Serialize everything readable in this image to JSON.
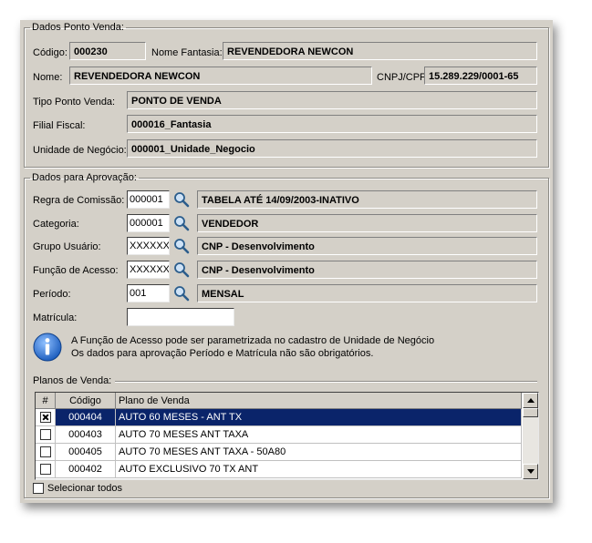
{
  "group_ponto_venda": {
    "legend": "Dados Ponto Venda:",
    "codigo_label": "Código:",
    "codigo_value": "000230",
    "nome_fantasia_label": "Nome Fantasia:",
    "nome_fantasia_value": "REVENDEDORA NEWCON",
    "nome_label": "Nome:",
    "nome_value": "REVENDEDORA NEWCON",
    "cnpj_label": "CNPJ/CPF:",
    "cnpj_value": "15.289.229/0001-65",
    "tipo_label": "Tipo Ponto Venda:",
    "tipo_value": "PONTO DE VENDA",
    "filial_label": "Filial Fiscal:",
    "filial_value": "000016_Fantasia",
    "unidade_label": "Unidade de Negócio:",
    "unidade_value": "000001_Unidade_Negocio"
  },
  "group_aprovacao": {
    "legend": "Dados para Aprovação:",
    "regra_label": "Regra de Comissão:",
    "regra_code": "000001",
    "regra_desc": "TABELA ATÉ 14/09/2003-INATIVO",
    "categoria_label": "Categoria:",
    "categoria_code": "000001",
    "categoria_desc": "VENDEDOR",
    "grupo_label": "Grupo Usuário:",
    "grupo_code": "XXXXXX",
    "grupo_desc": "CNP - Desenvolvimento",
    "funcao_label": "Função de Acesso:",
    "funcao_code": "XXXXXX",
    "funcao_desc": "CNP - Desenvolvimento",
    "periodo_label": "Período:",
    "periodo_code": "001",
    "periodo_desc": "MENSAL",
    "matricula_label": "Matrícula:",
    "matricula_value": "",
    "info_line1": "A Função de Acesso pode ser parametrizada no cadastro de Unidade de Negócio",
    "info_line2": "Os dados para aprovação Período e Matrícula não são obrigatórios.",
    "planos_legend": "Planos de Venda:",
    "table": {
      "headers": [
        "#",
        "Código",
        "Plano de Venda"
      ],
      "rows": [
        {
          "checked": true,
          "codigo": "000404",
          "plano": "AUTO 60 MESES - ANT TX",
          "selected": true
        },
        {
          "checked": false,
          "codigo": "000403",
          "plano": "AUTO 70 MESES ANT TAXA",
          "selected": false
        },
        {
          "checked": false,
          "codigo": "000405",
          "plano": "AUTO 70 MESES ANT TAXA - 50A80",
          "selected": false
        },
        {
          "checked": false,
          "codigo": "000402",
          "plano": "AUTO EXCLUSIVO 70 TX ANT",
          "selected": false
        }
      ]
    },
    "select_all_label": "Selecionar todos"
  },
  "icons": [
    "search-icon",
    "info-icon",
    "scroll-up-icon",
    "scroll-down-icon"
  ],
  "colors": {
    "background": "#d4d0c8",
    "selection": "#0a246a",
    "info_icon": "#1f5fbf"
  }
}
